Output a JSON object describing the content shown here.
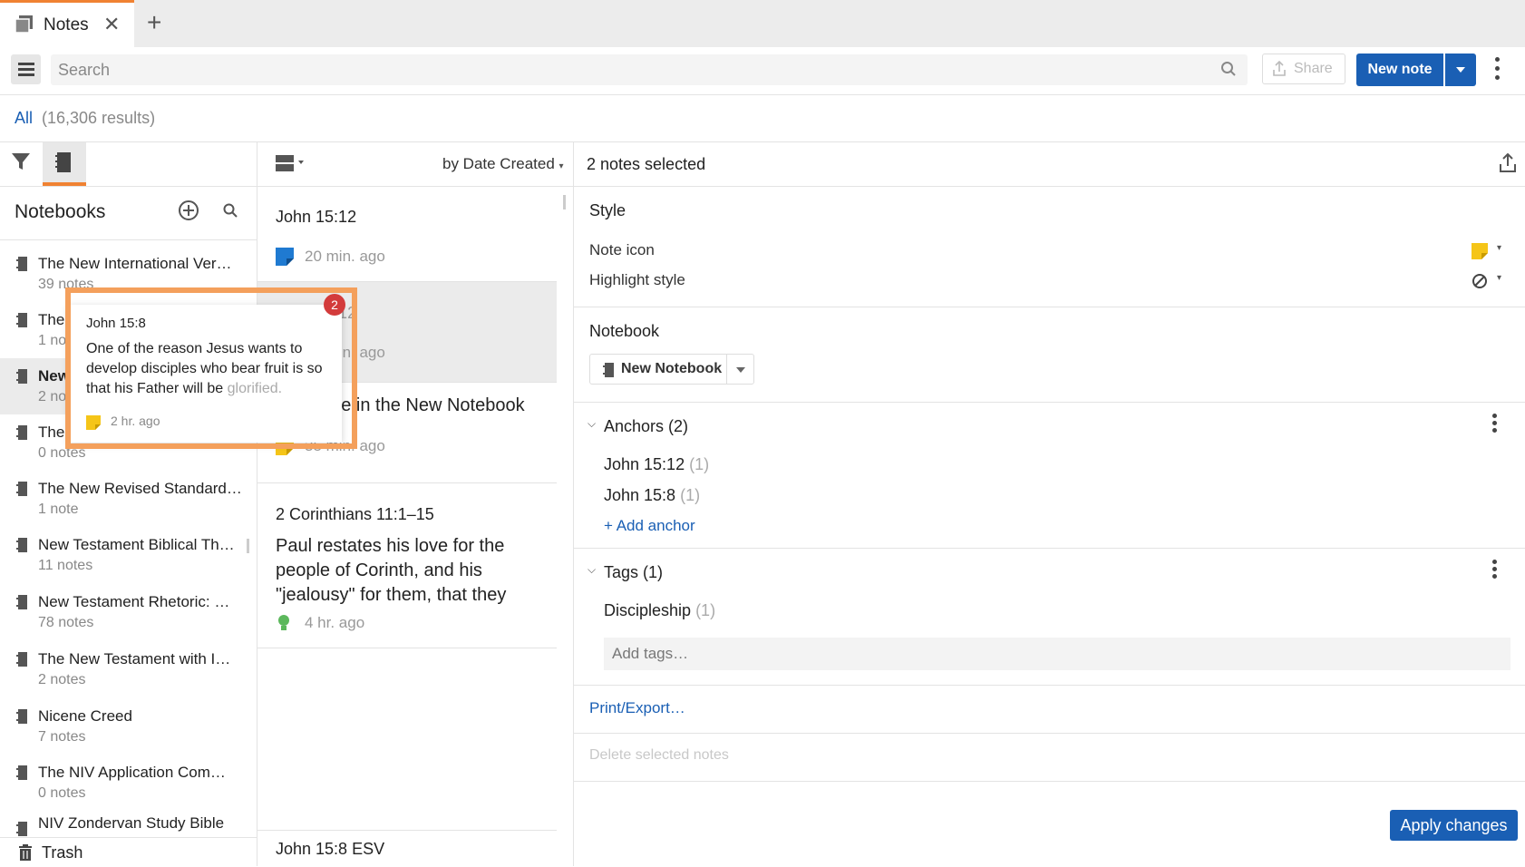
{
  "tab": {
    "title": "Notes"
  },
  "toolbar": {
    "search_placeholder": "Search",
    "share_label": "Share",
    "new_note_label": "New note"
  },
  "results": {
    "filter": "All",
    "count": "(16,306 results)"
  },
  "left": {
    "heading": "Notebooks",
    "notebooks": [
      {
        "name": "The New International Ver…",
        "sub": "39 notes"
      },
      {
        "name": "The…",
        "sub": "1 note"
      },
      {
        "name": "New",
        "sub": "2 notes"
      },
      {
        "name": "The",
        "sub": "0 notes"
      },
      {
        "name": "The New Revised Standard…",
        "sub": "1 note"
      },
      {
        "name": "New Testament Biblical Th…",
        "sub": "11 notes"
      },
      {
        "name": "New Testament Rhetoric: …",
        "sub": "78 notes"
      },
      {
        "name": "The New Testament with I…",
        "sub": "2 notes"
      },
      {
        "name": "Nicene Creed",
        "sub": "7 notes"
      },
      {
        "name": "The NIV Application Com…",
        "sub": "0 notes"
      },
      {
        "name": "NIV Zondervan Study Bible",
        "sub": ""
      }
    ],
    "trash": "Trash"
  },
  "middle": {
    "sort": "by Date Created",
    "notes": [
      {
        "title": "John 15:12",
        "meta": "20 min. ago",
        "body": ""
      },
      {
        "title": "John 15:12",
        "meta": "20 min. ago",
        "body": ""
      },
      {
        "title": "",
        "meta": "35 min. ago",
        "body": "First note in the New Notebook"
      },
      {
        "title": "2 Corinthians 11:1–15",
        "meta": "4 hr. ago",
        "body": "Paul restates his love for the people of Corinth, and his \"jealousy\" for them, that they"
      },
      {
        "title": "John 15:8 ESV",
        "meta": "",
        "body": ""
      }
    ]
  },
  "right": {
    "selected": "2 notes selected",
    "style_heading": "Style",
    "note_icon_label": "Note icon",
    "highlight_label": "Highlight style",
    "notebook_heading": "Notebook",
    "notebook_value": "New Notebook",
    "anchors_heading": "Anchors (2)",
    "anchors": [
      {
        "name": "John 15:12",
        "count": "(1)"
      },
      {
        "name": "John 15:8",
        "count": "(1)"
      }
    ],
    "add_anchor": "+ Add anchor",
    "tags_heading": "Tags (1)",
    "tags": [
      {
        "name": "Discipleship",
        "count": "(1)"
      }
    ],
    "add_tags_placeholder": "Add tags…",
    "print_export": "Print/Export…",
    "delete_selected": "Delete selected notes",
    "apply": "Apply changes"
  },
  "popup": {
    "ref": "John 15:8",
    "text_main": "One of the reason Jesus wants to develop disciples who bear fruit is so that his Father will be",
    "text_faded": "glorified.",
    "meta": "2 hr. ago",
    "badge": "2"
  },
  "colors": {
    "accent": "#1a5fb4",
    "tab_accent": "#f08232",
    "highlight_box": "#f4a05c",
    "badge": "#d33b3b",
    "note_yellow": "#f5c518",
    "note_blue": "#1f7ad1",
    "bulb_green": "#5cb85c"
  }
}
